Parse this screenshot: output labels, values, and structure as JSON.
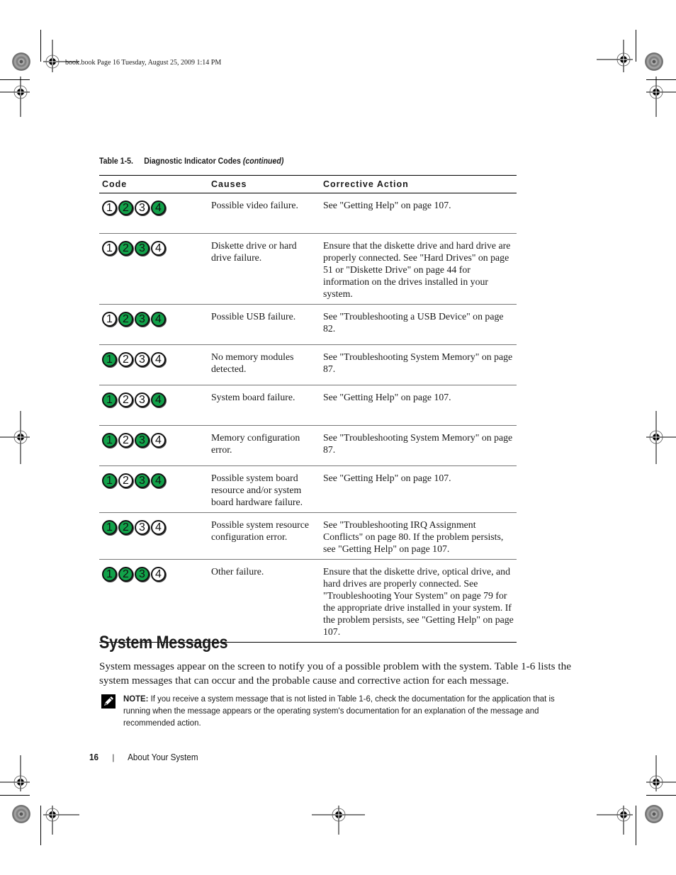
{
  "slug": "book.book  Page 16  Tuesday, August 25, 2009  1:14 PM",
  "table": {
    "number": "Table 1-5.",
    "title": "Diagnostic Indicator Codes",
    "continued": "(continued)",
    "columns": [
      "Code",
      "Causes",
      "Corrective Action"
    ],
    "led_colors": {
      "on": "#12a24a",
      "off": "#ffffff"
    },
    "rows": [
      {
        "leds": [
          false,
          true,
          false,
          true
        ],
        "cause": "Possible video failure.",
        "action": "See \"Getting Help\" on page 107."
      },
      {
        "leds": [
          false,
          true,
          true,
          false
        ],
        "cause": "Diskette drive or hard drive failure.",
        "action": "Ensure that the diskette drive and hard drive are properly connected. See \"Hard Drives\" on page 51 or \"Diskette Drive\" on page 44 for information on the drives installed in your system."
      },
      {
        "leds": [
          false,
          true,
          true,
          true
        ],
        "cause": "Possible USB failure.",
        "action": "See \"Troubleshooting a USB Device\" on page 82."
      },
      {
        "leds": [
          true,
          false,
          false,
          false
        ],
        "cause": "No memory modules detected.",
        "action": "See \"Troubleshooting System Memory\" on page 87."
      },
      {
        "leds": [
          true,
          false,
          false,
          true
        ],
        "cause": "System board failure.",
        "action": "See \"Getting Help\" on page 107."
      },
      {
        "leds": [
          true,
          false,
          true,
          false
        ],
        "cause": "Memory configuration error.",
        "action": "See \"Troubleshooting System Memory\" on page 87."
      },
      {
        "leds": [
          true,
          false,
          true,
          true
        ],
        "cause": "Possible system board resource and/or system board hardware failure.",
        "action": "See \"Getting Help\" on page 107."
      },
      {
        "leds": [
          true,
          true,
          false,
          false
        ],
        "cause": "Possible system resource configuration error.",
        "action": "See \"Troubleshooting IRQ Assignment Conflicts\" on page 80. If the problem persists, see \"Getting Help\" on page 107."
      },
      {
        "leds": [
          true,
          true,
          true,
          false
        ],
        "cause": "Other failure.",
        "action": "Ensure that the diskette drive, optical drive, and hard drives are properly connected. See \"Troubleshooting Your System\" on page 79 for the appropriate drive installed in your system. If the problem persists, see \"Getting Help\" on page 107."
      }
    ]
  },
  "section": {
    "heading": "System Messages",
    "body": "System messages appear on the screen to notify you of a possible problem with the system. Table 1-6 lists the system messages that can occur and the probable cause and corrective action for each message.",
    "note_label": "NOTE:",
    "note_text": " If you receive a system message that is not listed in Table 1-6, check the documentation for the application that is running when the message appears or the operating system's documentation for an explanation of the message and recommended action.",
    "note_icon": "pencil-note-icon"
  },
  "footer": {
    "page_number": "16",
    "separator": "|",
    "chapter": "About Your System"
  }
}
